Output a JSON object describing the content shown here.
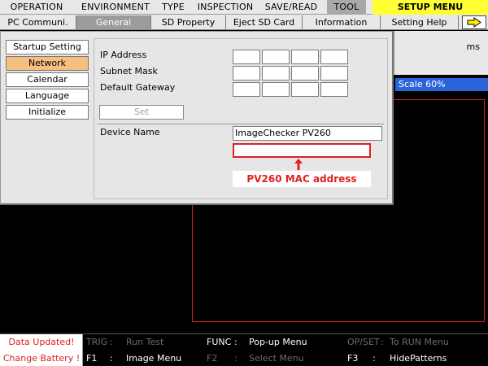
{
  "menu": {
    "items": [
      "OPERATION",
      "ENVIRONMENT",
      "TYPE",
      "INSPECTION",
      "SAVE/READ",
      "TOOL"
    ],
    "setup": "SETUP MENU"
  },
  "tabs": {
    "items": [
      "PC Communi.",
      "General",
      "SD Property",
      "Eject SD Card",
      "Information",
      "Setting Help"
    ]
  },
  "side_menu": {
    "items": [
      "Startup Setting",
      "Network",
      "Calendar",
      "Language",
      "Initialize"
    ]
  },
  "form": {
    "ip_label": "IP Address",
    "subnet_label": "Subnet Mask",
    "gateway_label": "Default Gateway",
    "set_label": "Set",
    "device_name_label": "Device Name",
    "device_name_value": "ImageChecker PV260",
    "mac_note": "PV260 MAC address"
  },
  "right_panel": {
    "unit": "ms",
    "scale": "Scale 60%"
  },
  "status": {
    "line1": "Data Updated!",
    "line2": "Change Battery !"
  },
  "fkeys": {
    "trig_key": "TRIG",
    "trig_label": "Run Test",
    "func_key": "FUNC",
    "func_label": "Pop-up Menu",
    "opset_key": "OP/SET",
    "opset_label": "To RUN Menu",
    "f1_key": "F1",
    "f1_label": "Image Menu",
    "f2_key": "F2",
    "f2_label": "Select Menu",
    "f3_key": "F3",
    "f3_label": "HidePatterns"
  },
  "colors": {
    "setup_menu_bg": "#ffff33",
    "active_side_item": "#f5bf80",
    "scale_bg": "#2a64d8",
    "alert_red": "#e02020"
  },
  "icons": {
    "tab_next": "arrow-right-icon",
    "mac_pointer": "arrow-up-icon"
  }
}
